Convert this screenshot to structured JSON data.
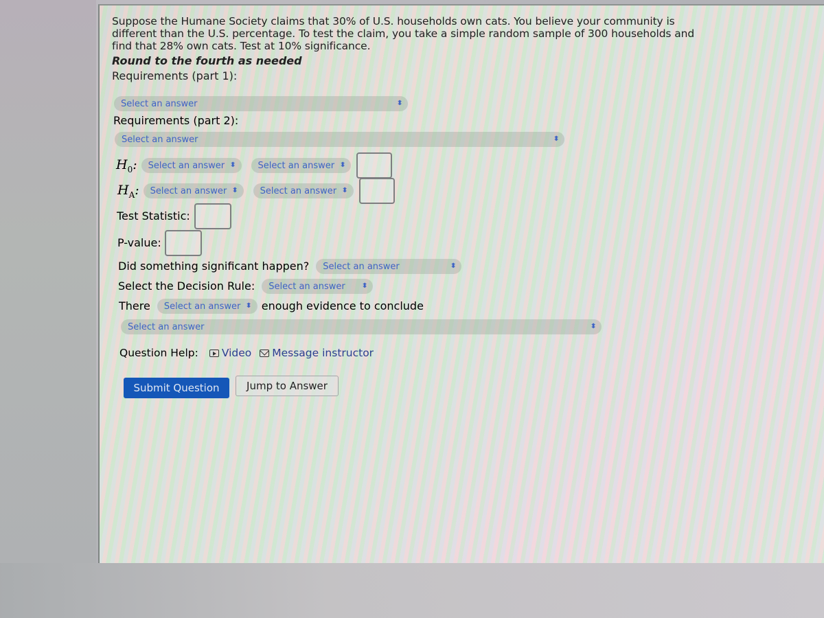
{
  "question": {
    "text_lines": [
      "Suppose the Humane Society claims that 30% of U.S. households own cats. You believe your community is",
      "different than the U.S. percentage. To test the claim, you take a simple random sample of 300 households and",
      "find that 28% own cats. Test at 10% significance."
    ],
    "note": "Round to the fourth as needed"
  },
  "requirements": {
    "part1_label": "Requirements (part 1):",
    "part1_select": "Select an answer",
    "part2_label": "Requirements (part 2):",
    "part2_select": "Select an answer"
  },
  "hypotheses": {
    "h0_symbol": "H",
    "h0_sub": "0",
    "h0_select1": "Select an answer",
    "h0_select2": "Select an answer",
    "h0_value": "",
    "ha_symbol": "H",
    "ha_sub": "A",
    "ha_select1": "Select an answer",
    "ha_select2": "Select an answer",
    "ha_value": ""
  },
  "test_statistic": {
    "label": "Test Statistic:",
    "value": ""
  },
  "p_value": {
    "label": "P-value:",
    "value": ""
  },
  "significance": {
    "label": "Did something significant happen?",
    "select": "Select an answer"
  },
  "decision_rule": {
    "label": "Select the Decision Rule:",
    "select": "Select an answer"
  },
  "conclusion": {
    "prefix": "There",
    "select": "Select an answer",
    "suffix": "enough evidence to conclude",
    "final_select": "Select an answer"
  },
  "help": {
    "label": "Question Help:",
    "video_label": "Video",
    "message_label": "Message instructor"
  },
  "buttons": {
    "submit": "Submit Question",
    "jump": "Jump to Answer"
  },
  "icons": {
    "select_arrow": "⬍",
    "video": "play-box-icon",
    "message": "envelope-icon"
  },
  "colors": {
    "link_blue": "#3f63c4",
    "primary_button": "#1557b8"
  }
}
